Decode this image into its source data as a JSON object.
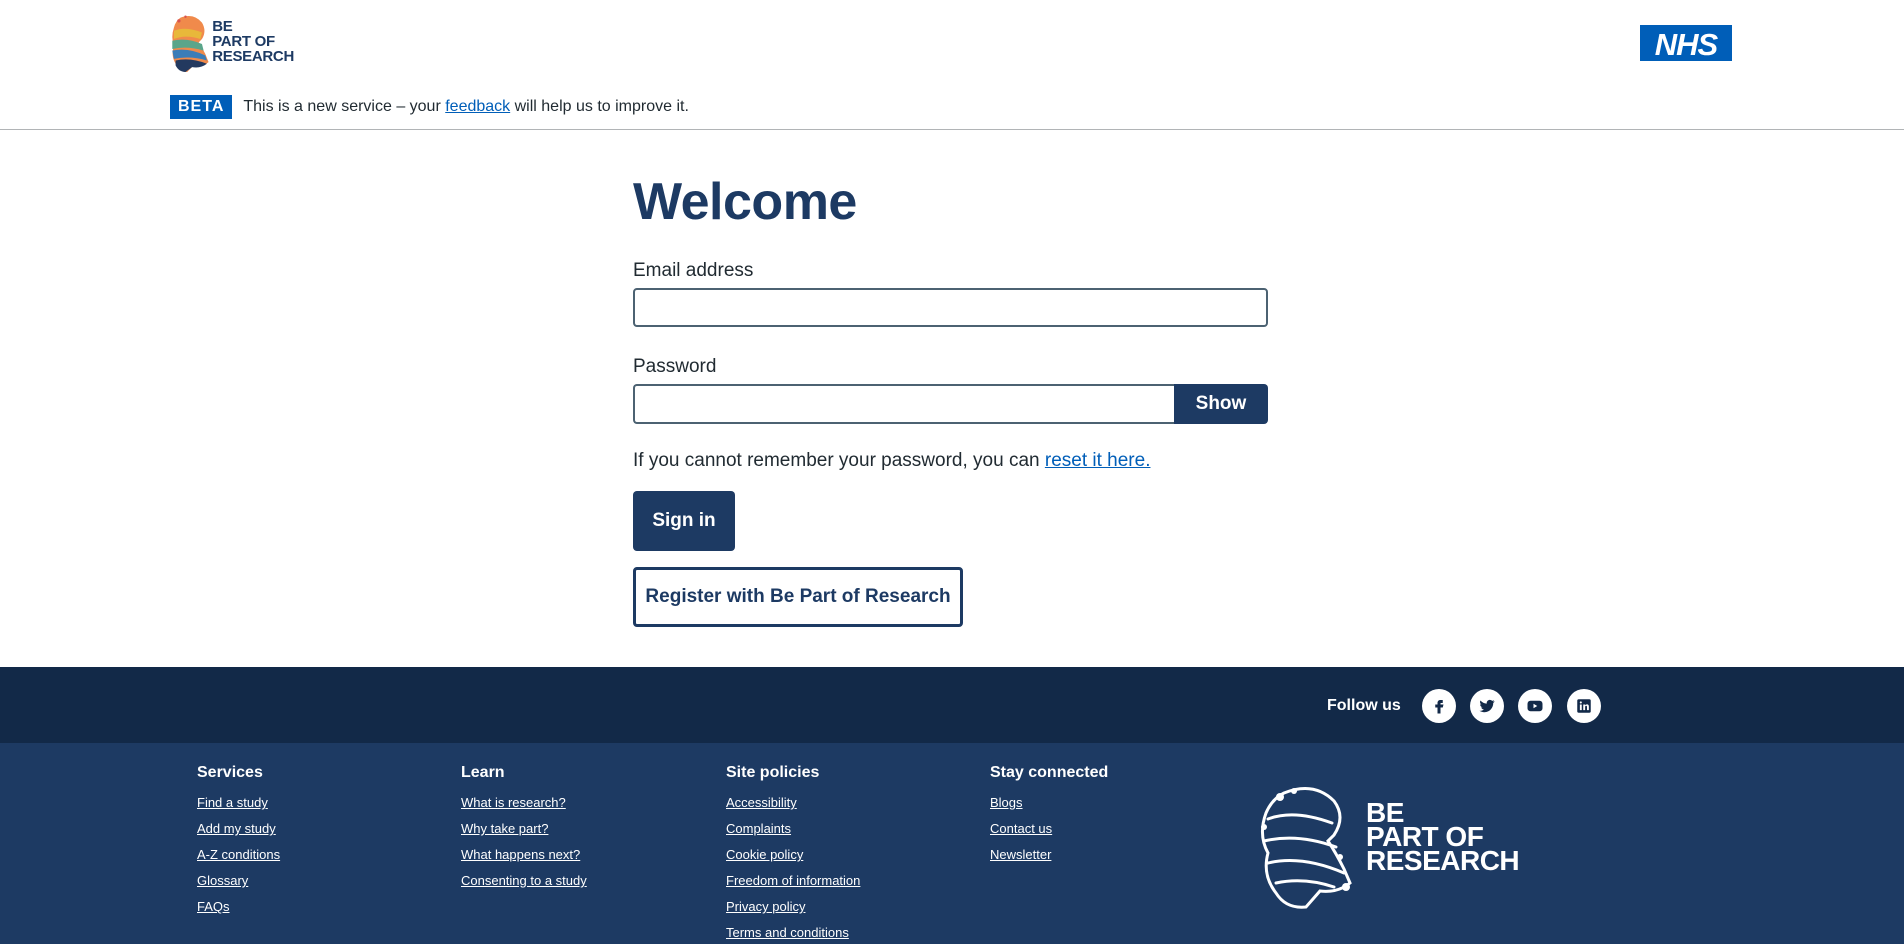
{
  "header": {
    "logo_lines": [
      "BE",
      "PART OF",
      "RESEARCH"
    ],
    "nhs_logo": "NHS",
    "beta_tag": "BETA",
    "beta_before": "This is a new service – your ",
    "beta_link": "feedback",
    "beta_after": " will help us to improve it."
  },
  "main": {
    "title": "Welcome",
    "email_label": "Email address",
    "email_value": "",
    "password_label": "Password",
    "password_value": "",
    "show_button": "Show",
    "reset_before": "If you cannot remember your password, you can ",
    "reset_link": "reset it here.",
    "signin_button": "Sign in",
    "register_button": "Register with Be Part of Research"
  },
  "footer": {
    "follow_us": "Follow us",
    "social_icons": [
      "facebook-icon",
      "twitter-icon",
      "youtube-icon",
      "linkedin-icon"
    ],
    "columns": [
      {
        "heading": "Services",
        "links": [
          "Find a study",
          "Add my study",
          "A-Z conditions",
          "Glossary",
          "FAQs"
        ]
      },
      {
        "heading": "Learn",
        "links": [
          "What is research?",
          "Why take part?",
          "What happens next?",
          "Consenting to a study"
        ]
      },
      {
        "heading": "Site policies",
        "links": [
          "Accessibility",
          "Complaints",
          "Cookie policy",
          "Freedom of information",
          "Privacy policy",
          "Terms and conditions"
        ]
      },
      {
        "heading": "Stay connected",
        "links": [
          "Blogs",
          "Contact us",
          "Newsletter"
        ]
      }
    ],
    "logo_lines": [
      "BE",
      "PART OF",
      "RESEARCH"
    ]
  },
  "colors": {
    "primary": "#1d3a63",
    "link": "#005eb8",
    "footer_dark": "#122948",
    "nhs_blue": "#005eb8"
  }
}
